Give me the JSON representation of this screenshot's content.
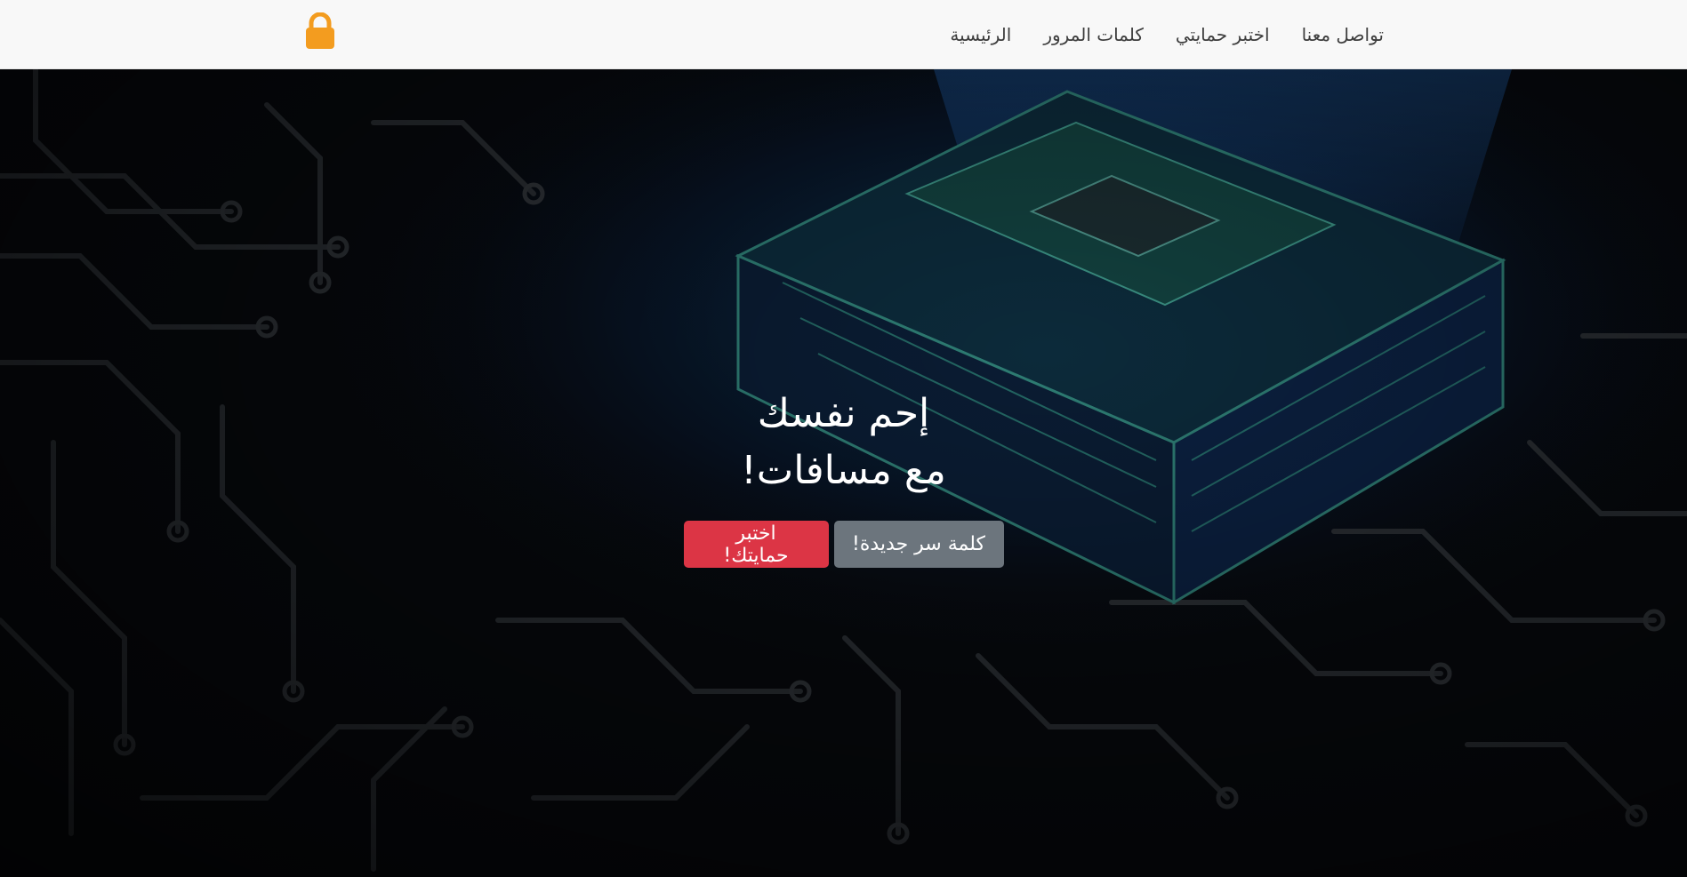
{
  "nav": {
    "brand_icon": "lock-icon",
    "brand_color": "#f39c1f",
    "links": [
      {
        "label": "الرئيسية"
      },
      {
        "label": "كلمات المرور"
      },
      {
        "label": "اختبر حمايتي"
      },
      {
        "label": "تواصل معنا"
      }
    ]
  },
  "hero": {
    "background": "circuit-board-cpu-image",
    "title_line1": "إحم نفسك",
    "title_line2": "مع مسافات!",
    "buttons": {
      "primary_label": "اختبر حمايتك!",
      "primary_color": "#dc3545",
      "secondary_label": "كلمة سر جديدة!",
      "secondary_color": "#6c757d"
    }
  }
}
